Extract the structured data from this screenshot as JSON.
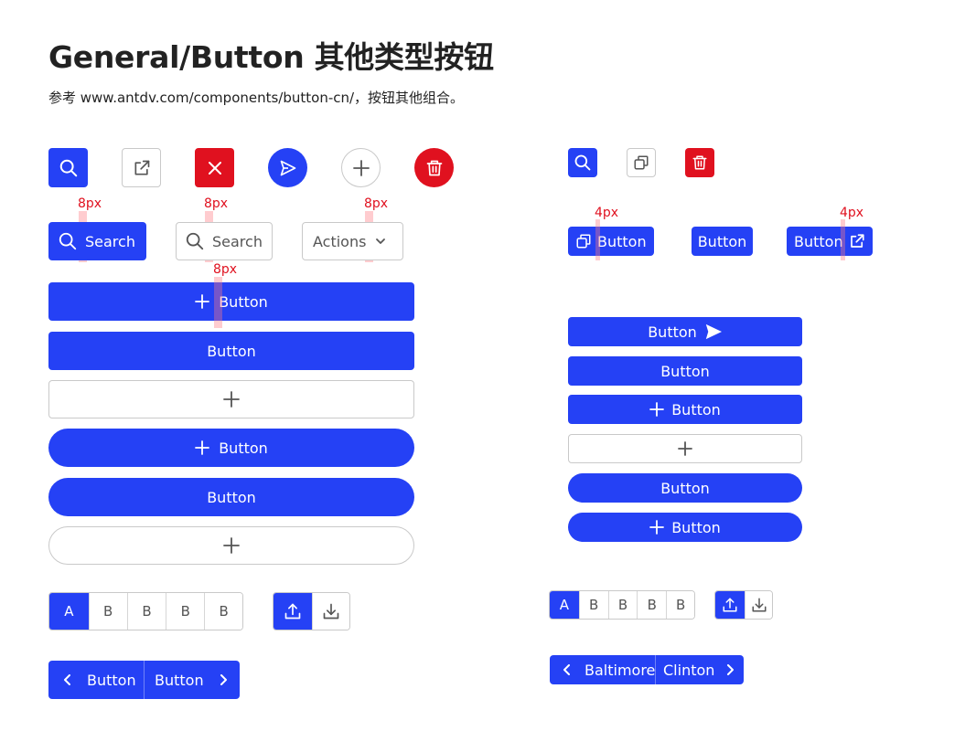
{
  "header": {
    "title": "General/Button 其他类型按钮",
    "subtitle": "参考 www.antdv.com/components/button-cn/，按钮其他组合。"
  },
  "spacing": {
    "large": "8px",
    "small": "4px"
  },
  "left": {
    "search_label": "Search",
    "actions_label": "Actions",
    "wide_buttons": {
      "add_label": "Button",
      "plain_label": "Button",
      "round_add_label": "Button",
      "round_plain_label": "Button"
    },
    "segment": [
      "A",
      "B",
      "B",
      "B",
      "B"
    ],
    "pager": {
      "prev_label": "Button",
      "next_label": "Button"
    }
  },
  "right": {
    "copy_label": "Button",
    "plain_label": "Button",
    "external_label": "Button",
    "stack": {
      "send_label": "Button",
      "plain_label": "Button",
      "add_label": "Button",
      "round_plain_label": "Button",
      "round_add_label": "Button"
    },
    "segment": [
      "A",
      "B",
      "B",
      "B",
      "B"
    ],
    "pager": {
      "prev_label": "Baltimore",
      "next_label": "Clinton"
    }
  },
  "colors": {
    "primary": "#2541f5",
    "danger": "#e0111f",
    "marker": "#ff7882",
    "border": "#c9c9c9"
  },
  "icons": [
    "search-icon",
    "external-link-icon",
    "close-icon",
    "send-icon",
    "plus-icon",
    "trash-icon",
    "copy-icon",
    "chevron-down-icon",
    "upload-icon",
    "download-icon",
    "chevron-left-icon",
    "chevron-right-icon"
  ]
}
